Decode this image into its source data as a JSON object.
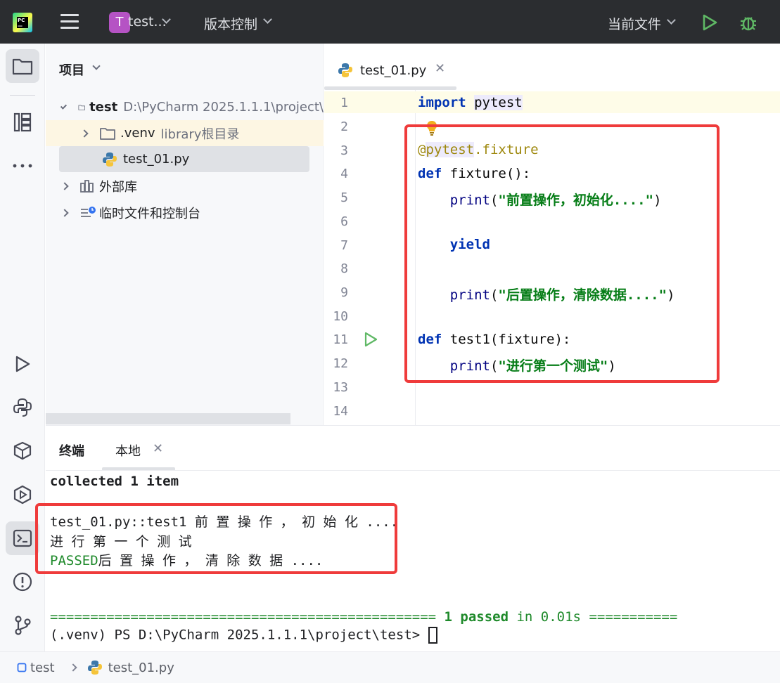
{
  "titlebar": {
    "project_initial": "T",
    "project_name": "test...",
    "vcs_label": "版本控制",
    "run_config": "当前文件"
  },
  "project_panel": {
    "title": "项目",
    "tree": [
      {
        "name": "test",
        "detail": "D:\\PyCharm 2025.1.1.1\\project\\",
        "kind": "folder",
        "expanded": true
      },
      {
        "name": ".venv",
        "detail": "library根目录",
        "kind": "folder",
        "expanded": false
      },
      {
        "name": "test_01.py",
        "kind": "python-file",
        "selected": true
      },
      {
        "name": "外部库",
        "kind": "library"
      },
      {
        "name": "临时文件和控制台",
        "kind": "scratches"
      }
    ]
  },
  "editor": {
    "tab_name": "test_01.py",
    "line_numbers": [
      "1",
      "2",
      "3",
      "4",
      "5",
      "6",
      "7",
      "8",
      "9",
      "10",
      "11",
      "12",
      "13",
      "14"
    ],
    "code": {
      "l1_kw": "import",
      "l1_mod": "pytest",
      "l3_at": "@",
      "l3_mod": "pytest",
      "l3_rest": ".fixture",
      "l4_kw": "def",
      "l4_rest": " fixture():",
      "l5_fn": "print",
      "l5_str": "\"前置操作，初始化....\"",
      "l7_kw": "yield",
      "l9_fn": "print",
      "l9_str": "\"后置操作，清除数据....\"",
      "l11_kw": "def",
      "l11_rest": " test1(fixture):",
      "l12_fn": "print",
      "l12_str": "\"进行第一个测试\""
    }
  },
  "terminal": {
    "title": "终端",
    "tab": "本地",
    "lines": {
      "collected": "collected 1 item",
      "out1": "test_01.py::test1 前 置 操 作 ， 初 始 化 ....",
      "out2": "进 行 第 一 个 测 试",
      "passed": "PASSED",
      "out3": "后 置 操 作 ， 清 除 数 据 ....",
      "summary_left": "================================================ ",
      "summary_count": "1 passed",
      "summary_in": " in ",
      "summary_time": "0.01s",
      "summary_right": " ===========",
      "prompt": "(.venv) PS D:\\PyCharm 2025.1.1.1\\project\\test> "
    }
  },
  "statusbar": {
    "crumb_project": "test",
    "crumb_file": "test_01.py"
  },
  "colors": {
    "accent_red": "#ef3b3b",
    "keyword": "#0033b3",
    "string": "#067d17",
    "pass_green": "#1f8a2b"
  }
}
